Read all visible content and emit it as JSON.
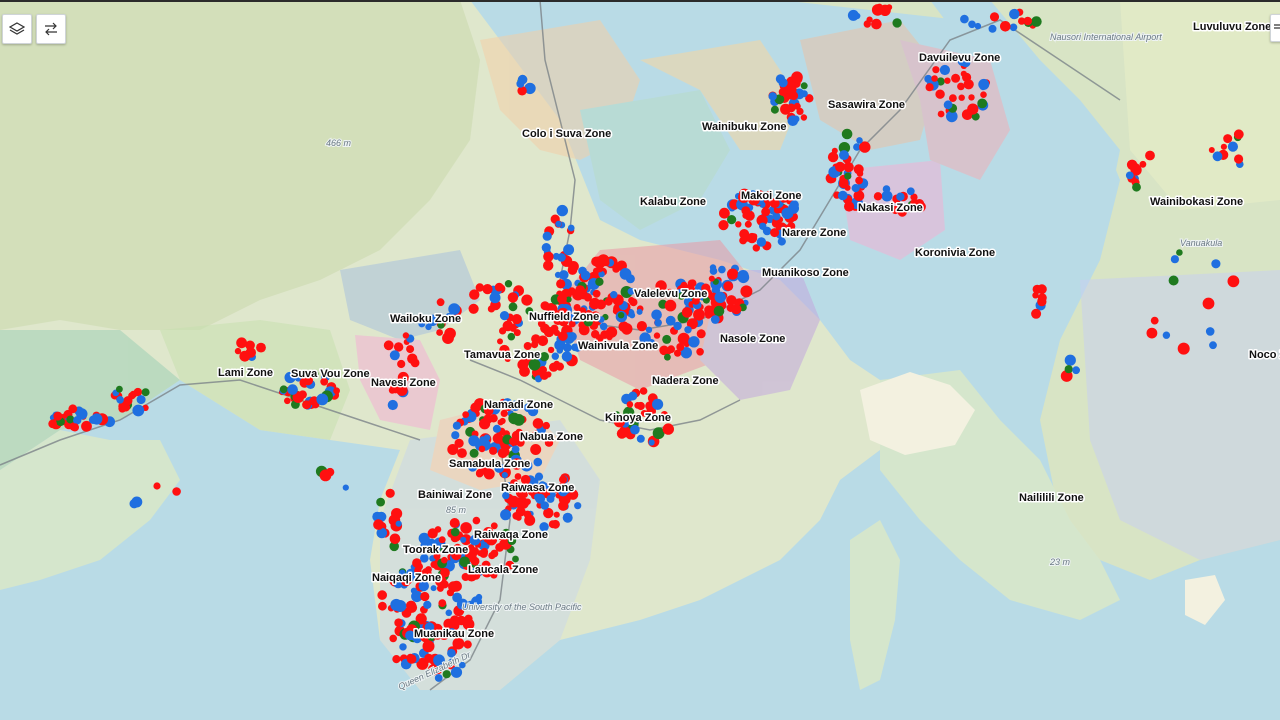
{
  "toolbar": {
    "layers_icon": "layers-icon",
    "swap_icon": "swap-arrows-icon",
    "right_icon": "collapse-icon"
  },
  "map": {
    "zones": [
      {
        "id": "luvuluvu",
        "label": "Luvuluvu Zone"
      },
      {
        "id": "davuilevu",
        "label": "Davuilevu Zone"
      },
      {
        "id": "sasawira",
        "label": "Sasawira Zone"
      },
      {
        "id": "wainibuku",
        "label": "Wainibuku Zone"
      },
      {
        "id": "colo-i-suva",
        "label": "Colo i Suva Zone"
      },
      {
        "id": "makoi",
        "label": "Makoi Zone"
      },
      {
        "id": "kalabu",
        "label": "Kalabu Zone"
      },
      {
        "id": "nakasi",
        "label": "Nakasi Zone"
      },
      {
        "id": "wainibokasi",
        "label": "Wainibokasi Zone"
      },
      {
        "id": "narere",
        "label": "Narere Zone"
      },
      {
        "id": "koronivia",
        "label": "Koronivia Zone"
      },
      {
        "id": "muanikoso",
        "label": "Muanikoso Zone"
      },
      {
        "id": "valelevu",
        "label": "Valelevu Zone"
      },
      {
        "id": "nuffield",
        "label": "Nuffield Zone"
      },
      {
        "id": "wailoku",
        "label": "Wailoku Zone"
      },
      {
        "id": "nasole",
        "label": "Nasole Zone"
      },
      {
        "id": "wainivula",
        "label": "Wainivula Zone"
      },
      {
        "id": "tamavua",
        "label": "Tamavua Zone"
      },
      {
        "id": "noco",
        "label": "Noco Z"
      },
      {
        "id": "lami",
        "label": "Lami Zone"
      },
      {
        "id": "suva-vou",
        "label": "Suva Vou Zone"
      },
      {
        "id": "nadera",
        "label": "Nadera Zone"
      },
      {
        "id": "navesi",
        "label": "Navesi Zone"
      },
      {
        "id": "namadi",
        "label": "Namadi Zone"
      },
      {
        "id": "kinoya",
        "label": "Kinoya Zone"
      },
      {
        "id": "nabua",
        "label": "Nabua Zone"
      },
      {
        "id": "samabula",
        "label": "Samabula Zone"
      },
      {
        "id": "raiwasa",
        "label": "Raiwasa Zone"
      },
      {
        "id": "bainiwai",
        "label": "Bainiwai Zone"
      },
      {
        "id": "nailili",
        "label": "Naililili Zone"
      },
      {
        "id": "raiwaqa",
        "label": "Raiwaqa Zone"
      },
      {
        "id": "toorak",
        "label": "Toorak Zone"
      },
      {
        "id": "laucala",
        "label": "Laucala Zone"
      },
      {
        "id": "naiqaqi",
        "label": "Naiqaqi Zone"
      },
      {
        "id": "muanikau",
        "label": "Muanikau Zone"
      }
    ],
    "places": [
      {
        "id": "elev-466",
        "label": "466 m"
      },
      {
        "id": "elev-23",
        "label": "23 m"
      },
      {
        "id": "elev-85",
        "label": "85 m"
      },
      {
        "id": "vanuakula",
        "label": "Vanuakula"
      },
      {
        "id": "airport",
        "label": "Nausori International Airport"
      },
      {
        "id": "usp",
        "label": "University of the South Pacific"
      },
      {
        "id": "qe-drive",
        "label": "Queen Elizabeth Dr"
      }
    ],
    "point_colors": {
      "red": "#ff1010",
      "blue": "#1f6fe0",
      "green": "#1f7a1f"
    }
  }
}
